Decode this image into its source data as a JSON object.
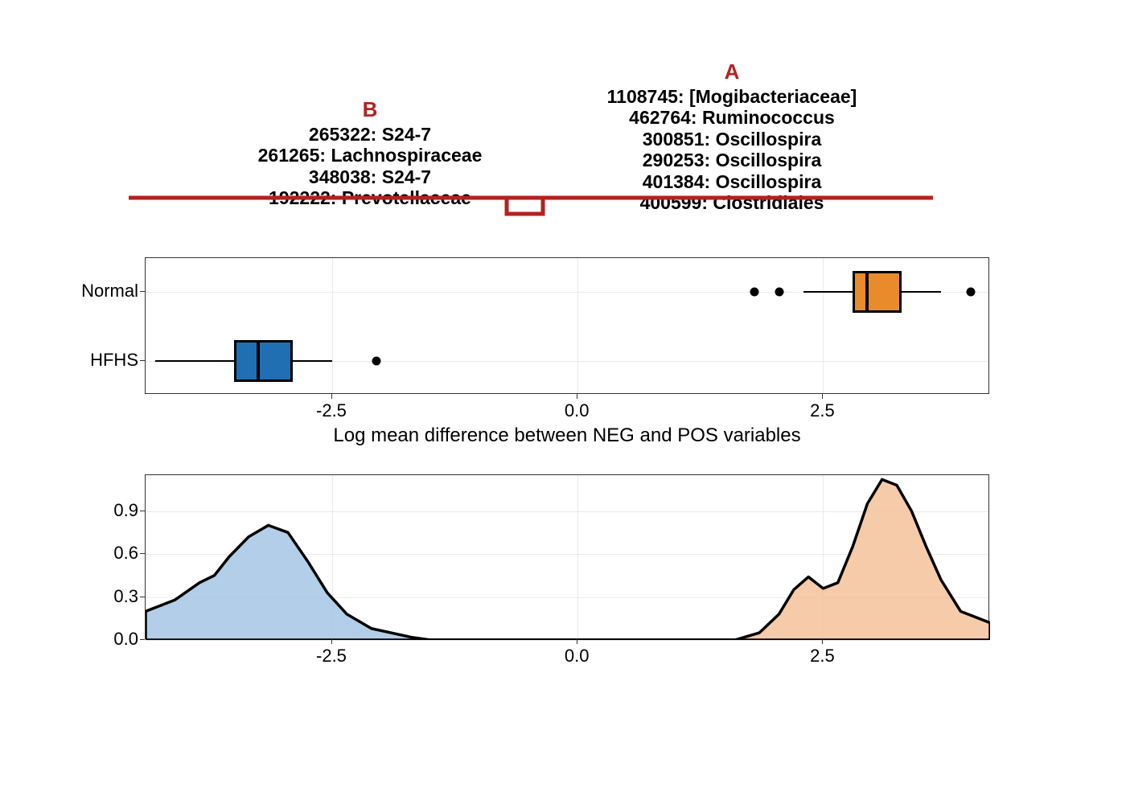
{
  "balance": {
    "labelB": "B",
    "labelA": "A",
    "groupB": [
      "265322: S24-7",
      "261265: Lachnospiraceae",
      "348038: S24-7",
      "192222: Prevotellaceae"
    ],
    "groupA": [
      "1108745: [Mogibacteriaceae]",
      "462764: Ruminococcus",
      "300851: Oscillospira",
      "290253: Oscillospira",
      "401384: Oscillospira",
      "400599: Clostridiales"
    ]
  },
  "chart_data": {
    "boxplot": {
      "type": "boxplot",
      "xlabel": "Log mean difference between NEG and POS variables",
      "ylabel": "",
      "xlim": [
        -4.4,
        4.2
      ],
      "xticks": [
        -2.5,
        0.0,
        2.5
      ],
      "categories": [
        "Normal",
        "HFHS"
      ],
      "series": [
        {
          "name": "Normal",
          "color": "#e98b2a",
          "whisker_low": 2.3,
          "q1": 2.8,
          "median": 2.95,
          "q3": 3.3,
          "whisker_high": 3.7,
          "outliers": [
            1.8,
            2.05,
            4.0
          ]
        },
        {
          "name": "HFHS",
          "color": "#1f6fb2",
          "whisker_low": -4.3,
          "q1": -3.5,
          "median": -3.25,
          "q3": -2.9,
          "whisker_high": -2.5,
          "outliers": [
            -2.05
          ]
        }
      ]
    },
    "density": {
      "type": "area",
      "xlim": [
        -4.4,
        4.2
      ],
      "ylim": [
        0.0,
        1.15
      ],
      "xticks": [
        -2.5,
        0.0,
        2.5
      ],
      "yticks": [
        0.0,
        0.3,
        0.6,
        0.9
      ],
      "series": [
        {
          "name": "HFHS",
          "color": "#a6c6e4",
          "points": [
            [
              -4.4,
              0.2
            ],
            [
              -4.1,
              0.28
            ],
            [
              -3.85,
              0.4
            ],
            [
              -3.7,
              0.45
            ],
            [
              -3.55,
              0.58
            ],
            [
              -3.35,
              0.72
            ],
            [
              -3.15,
              0.8
            ],
            [
              -2.95,
              0.75
            ],
            [
              -2.75,
              0.55
            ],
            [
              -2.55,
              0.33
            ],
            [
              -2.35,
              0.18
            ],
            [
              -2.1,
              0.08
            ],
            [
              -1.9,
              0.05
            ],
            [
              -1.7,
              0.02
            ],
            [
              -1.5,
              0.0
            ]
          ]
        },
        {
          "name": "Normal",
          "color": "#f3c29a",
          "points": [
            [
              1.6,
              0.0
            ],
            [
              1.85,
              0.05
            ],
            [
              2.05,
              0.18
            ],
            [
              2.2,
              0.35
            ],
            [
              2.35,
              0.44
            ],
            [
              2.5,
              0.36
            ],
            [
              2.65,
              0.4
            ],
            [
              2.8,
              0.65
            ],
            [
              2.95,
              0.95
            ],
            [
              3.1,
              1.12
            ],
            [
              3.25,
              1.08
            ],
            [
              3.4,
              0.9
            ],
            [
              3.55,
              0.65
            ],
            [
              3.7,
              0.42
            ],
            [
              3.9,
              0.2
            ],
            [
              4.2,
              0.12
            ]
          ]
        }
      ]
    }
  }
}
